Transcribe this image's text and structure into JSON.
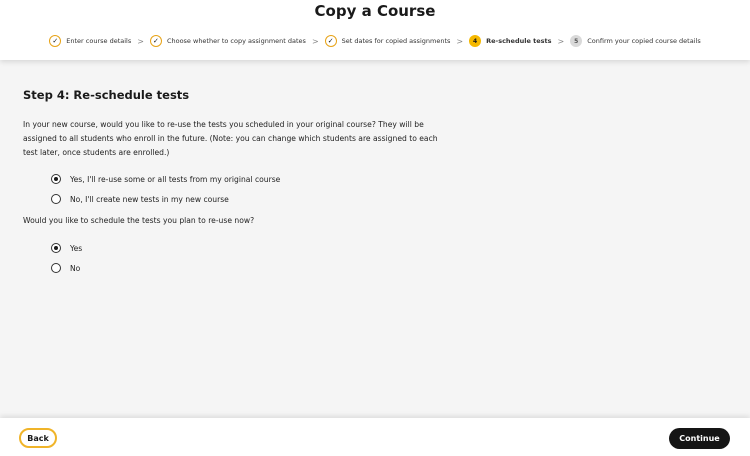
{
  "header": {
    "title": "Copy a Course",
    "steps": [
      {
        "label": "Enter course details",
        "badge": "✓",
        "state": "done"
      },
      {
        "label": "Choose whether to copy assignment dates",
        "badge": "✓",
        "state": "done"
      },
      {
        "label": "Set dates for copied assignments",
        "badge": "✓",
        "state": "done"
      },
      {
        "label": "Re-schedule tests",
        "badge": "4",
        "state": "current"
      },
      {
        "label": "Confirm your copied course details",
        "badge": "5",
        "state": "future"
      }
    ],
    "separator": ">"
  },
  "main": {
    "title": "Step 4: Re-schedule tests",
    "intro": "In your new course, would you like to re-use the tests you scheduled in your original course? They will be assigned to all students who enroll in the future. (Note: you can change which students are assigned to each test later, once students are enrolled.)",
    "reuse_options": [
      {
        "label": "Yes, I'll re-use some or all tests from my original course",
        "checked": true
      },
      {
        "label": "No, I'll create new tests in my new course",
        "checked": false
      }
    ],
    "schedule_question": "Would you like to schedule the tests you plan to re-use now?",
    "schedule_options": [
      {
        "label": "Yes",
        "checked": true
      },
      {
        "label": "No",
        "checked": false
      }
    ]
  },
  "footer": {
    "back_label": "Back",
    "continue_label": "Continue"
  },
  "colors": {
    "accent": "#f5b800",
    "accent_border": "#f0b429",
    "primary_button": "#151515",
    "background": "#f5f5f5"
  }
}
